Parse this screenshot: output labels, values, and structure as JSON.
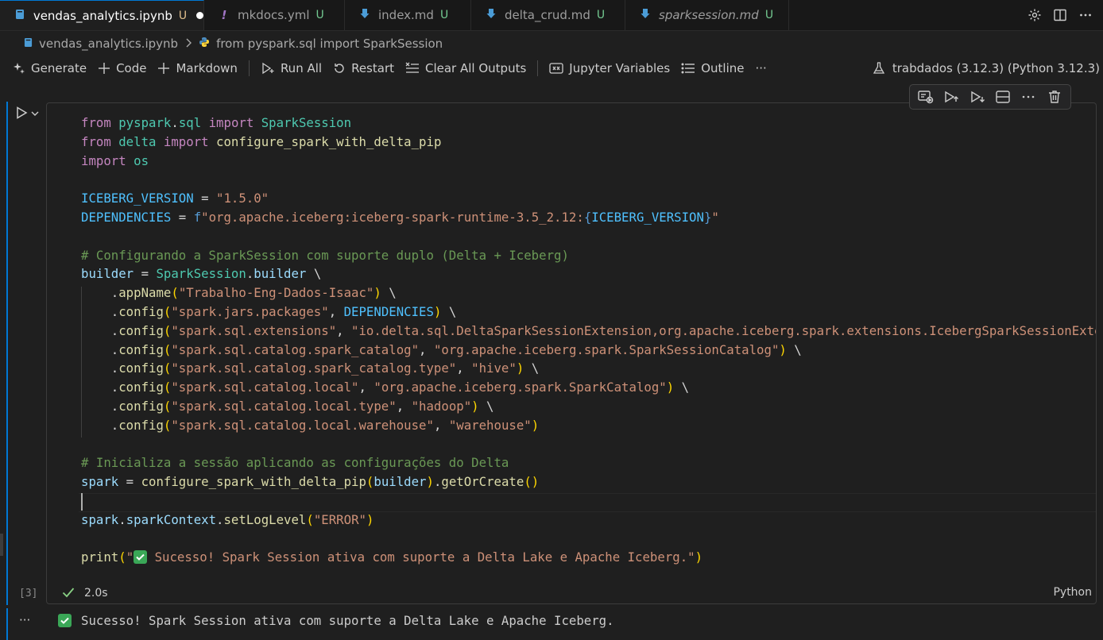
{
  "tabs": [
    {
      "name": "vendas_analytics.ipynb",
      "status": "U",
      "active": true,
      "dirty": true,
      "icon": "notebook-icon"
    },
    {
      "name": "mkdocs.yml",
      "status": "U",
      "icon": "yaml-icon",
      "icon_glyph": "!"
    },
    {
      "name": "index.md",
      "status": "U",
      "icon": "markdown-icon"
    },
    {
      "name": "delta_crud.md",
      "status": "U",
      "icon": "markdown-icon"
    },
    {
      "name": "sparksession.md",
      "status": "U",
      "icon": "markdown-icon"
    }
  ],
  "breadcrumb": {
    "file": "vendas_analytics.ipynb",
    "symbol": "from pyspark.sql import SparkSession"
  },
  "toolbar": {
    "generate": "Generate",
    "code": "Code",
    "markdown": "Markdown",
    "run_all": "Run All",
    "restart": "Restart",
    "clear_outputs": "Clear All Outputs",
    "variables": "Jupyter Variables",
    "outline": "Outline",
    "more": "···",
    "kernel": "trabdados (3.12.3) (Python 3.12.3)"
  },
  "cell": {
    "execution_count": "[3]",
    "duration": "2.0s",
    "language": "Python",
    "more": "···"
  },
  "output": {
    "text": "Sucesso! Spark Session ativa com suporte a Delta Lake e Apache Iceberg."
  },
  "colors": {
    "accent": "#0078d4",
    "success": "#3aa757",
    "background": "#1f1f1f"
  }
}
